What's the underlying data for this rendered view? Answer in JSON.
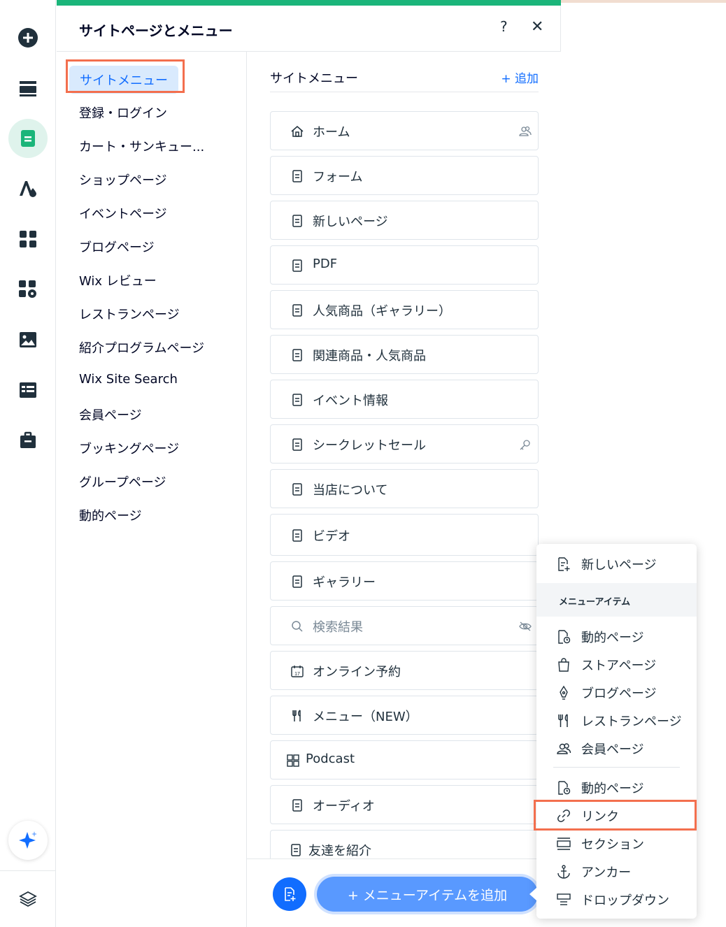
{
  "panel": {
    "title": "サイトページとメニュー",
    "help": "?",
    "close": "✕"
  },
  "nav": {
    "items": [
      "サイトメニュー",
      "登録・ログイン",
      "カート・サンキュー...",
      "ショップページ",
      "イベントページ",
      "ブログページ",
      "Wix レビュー",
      "レストランページ",
      "紹介プログラムページ",
      "Wix Site Search",
      "会員ページ",
      "ブッキングページ",
      "グループページ",
      "動的ページ"
    ]
  },
  "pages": {
    "title": "サイトメニュー",
    "add_label": "+ 追加",
    "rows": [
      {
        "label": "ホーム",
        "icon": "home-icon"
      },
      {
        "label": "フォーム",
        "icon": "page-icon"
      },
      {
        "label": "新しいページ",
        "icon": "page-icon"
      },
      {
        "label": "PDF",
        "icon": "page-icon"
      },
      {
        "label": "人気商品（ギャラリー）",
        "icon": "page-icon"
      },
      {
        "label": "関連商品・人気商品",
        "icon": "page-icon"
      },
      {
        "label": "イベント情報",
        "icon": "page-icon"
      },
      {
        "label": "シークレットセール",
        "icon": "page-icon"
      },
      {
        "label": "当店について",
        "icon": "page-icon"
      },
      {
        "label": "ビデオ",
        "icon": "page-icon"
      },
      {
        "label": "ギャラリー",
        "icon": "page-icon"
      },
      {
        "label": "検索結果",
        "icon": "search-icon"
      },
      {
        "label": "オンライン予約",
        "icon": "calendar-icon"
      },
      {
        "label": "メニュー（NEW）",
        "icon": "fork-knife-icon"
      },
      {
        "label": "Podcast",
        "icon": "grid-icon"
      },
      {
        "label": "オーディオ",
        "icon": "page-icon"
      },
      {
        "label": "友達を紹介",
        "icon": "page-icon"
      }
    ],
    "add_item_button": "+ メニューアイテムを追加"
  },
  "dropdown": {
    "new_page": "新しいページ",
    "section_title": "メニューアイテム",
    "items": [
      "動的ページ",
      "ストアページ",
      "ブログページ",
      "レストランページ",
      "会員ページ"
    ],
    "items2": [
      "動的ページ",
      "リンク",
      "セクション",
      "アンカー",
      "ドロップダウン"
    ]
  },
  "colors": {
    "accent_green": "#1bb57a",
    "primary_blue": "#116dff",
    "highlight": "#f36f4e"
  }
}
